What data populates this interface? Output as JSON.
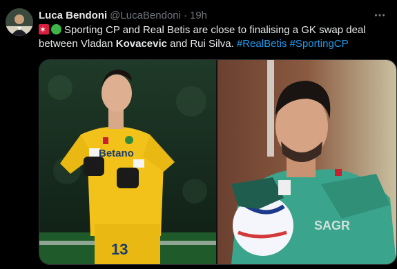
{
  "tweet": {
    "display_name": "Luca Bendoni",
    "handle": "@LucaBendoni",
    "separator": "·",
    "time": "19h",
    "more_icon": "more-horizontal-icon",
    "text": {
      "part1": "Sporting CP and Real Betis are close to finalising a GK swap deal between Vladan ",
      "bold": "Kovacevic",
      "part2": " and Rui Silva. ",
      "hashtag1": "#RealBetis",
      "hashtag2": "#SportingCP"
    },
    "media": {
      "left_jersey_sponsor": "Betano",
      "left_jersey_number": "13",
      "right_jersey_text": "SAGR"
    }
  },
  "colors": {
    "background": "#000000",
    "text": "#e7e9ea",
    "muted": "#71767b",
    "link": "#1d9bf0",
    "left_kit": "#f2c21a",
    "right_kit": "#3aa58c"
  }
}
